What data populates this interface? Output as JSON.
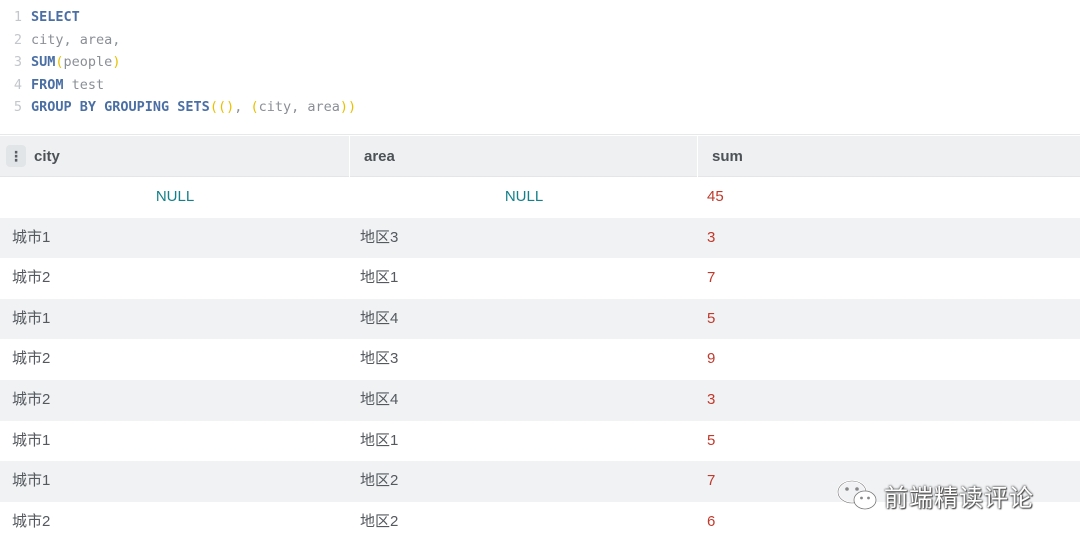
{
  "editor": {
    "lines": [
      {
        "no": "1",
        "tokens": [
          {
            "t": "SELECT",
            "k": "kw"
          }
        ]
      },
      {
        "no": "2",
        "tokens": [
          {
            "t": "city, area,",
            "k": "id"
          }
        ]
      },
      {
        "no": "3",
        "tokens": [
          {
            "t": "SUM",
            "k": "kw"
          },
          {
            "t": "(",
            "k": "paren"
          },
          {
            "t": "people",
            "k": "id"
          },
          {
            "t": ")",
            "k": "paren"
          }
        ]
      },
      {
        "no": "4",
        "tokens": [
          {
            "t": "FROM",
            "k": "kw"
          },
          {
            "t": " test",
            "k": "id"
          }
        ]
      },
      {
        "no": "5",
        "tokens": [
          {
            "t": "GROUP BY GROUPING SETS",
            "k": "kw"
          },
          {
            "t": "((",
            "k": "paren"
          },
          {
            "t": ")",
            "k": "paren"
          },
          {
            "t": ", ",
            "k": "id"
          },
          {
            "t": "(",
            "k": "paren"
          },
          {
            "t": "city, area",
            "k": "id"
          },
          {
            "t": "))",
            "k": "paren"
          }
        ]
      }
    ]
  },
  "table": {
    "columns": [
      "city",
      "area",
      "sum"
    ],
    "drag_handle": "⋮",
    "rows": [
      {
        "city": "NULL",
        "area": "NULL",
        "sum": "45",
        "null": true
      },
      {
        "city": "城市1",
        "area": "地区3",
        "sum": "3"
      },
      {
        "city": "城市2",
        "area": "地区1",
        "sum": "7"
      },
      {
        "city": "城市1",
        "area": "地区4",
        "sum": "5"
      },
      {
        "city": "城市2",
        "area": "地区3",
        "sum": "9"
      },
      {
        "city": "城市2",
        "area": "地区4",
        "sum": "3"
      },
      {
        "city": "城市1",
        "area": "地区1",
        "sum": "5"
      },
      {
        "city": "城市1",
        "area": "地区2",
        "sum": "7"
      },
      {
        "city": "城市2",
        "area": "地区2",
        "sum": "6"
      }
    ]
  },
  "watermark": {
    "text": "前端精读评论",
    "icon": "wechat-icon"
  },
  "colors": {
    "keyword": "#4a6fa5",
    "paren": "#e8c100",
    "null_value": "#13808a",
    "sum_value": "#c0392b",
    "header_bg": "#eef0f2",
    "stripe_bg": "#f0f2f4"
  }
}
